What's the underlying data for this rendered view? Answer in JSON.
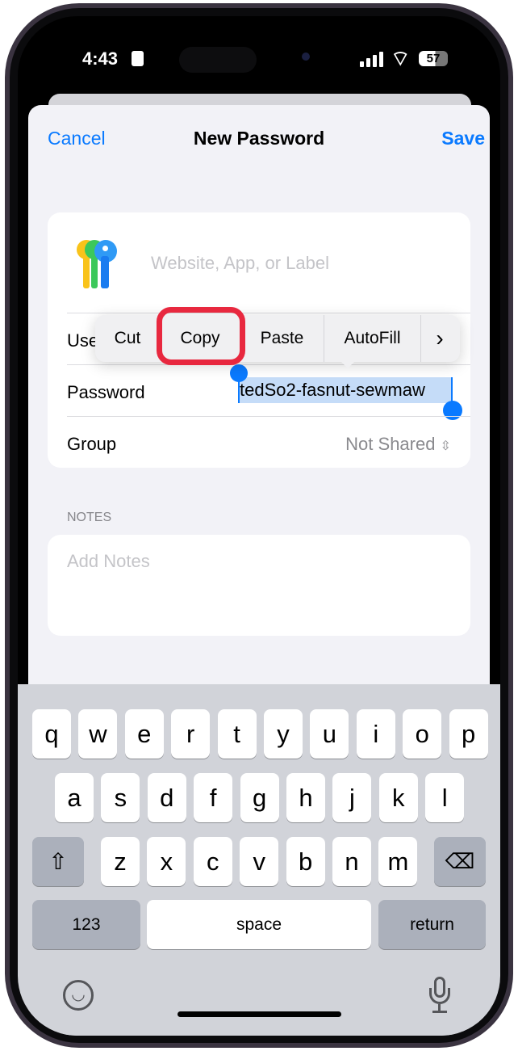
{
  "status_bar": {
    "time": "4:43",
    "battery": "57",
    "icons": [
      "contact-card-icon",
      "cellular-signal-icon",
      "wifi-icon",
      "battery-icon"
    ]
  },
  "nav": {
    "cancel": "Cancel",
    "title": "New Password",
    "save": "Save"
  },
  "form": {
    "website_placeholder": "Website, App, or Label",
    "username_label": "Use",
    "password_label": "Password",
    "password_value": "tedSo2-fasnut-sewmaw",
    "group_label": "Group",
    "group_value": "Not Shared",
    "notes_header": "NOTES",
    "notes_placeholder": "Add Notes"
  },
  "edit_menu": {
    "items": [
      "Cut",
      "Copy",
      "Paste",
      "AutoFill"
    ],
    "more": "›",
    "highlighted": "Copy"
  },
  "keyboard": {
    "row1": [
      "q",
      "w",
      "e",
      "r",
      "t",
      "y",
      "u",
      "i",
      "o",
      "p"
    ],
    "row2": [
      "a",
      "s",
      "d",
      "f",
      "g",
      "h",
      "j",
      "k",
      "l"
    ],
    "row3": [
      "z",
      "x",
      "c",
      "v",
      "b",
      "n",
      "m"
    ],
    "numbers": "123",
    "space": "space",
    "return": "return"
  },
  "colors": {
    "accent": "#0a7aff",
    "highlight": "#e8283f",
    "selection": "#c5dcf8"
  }
}
